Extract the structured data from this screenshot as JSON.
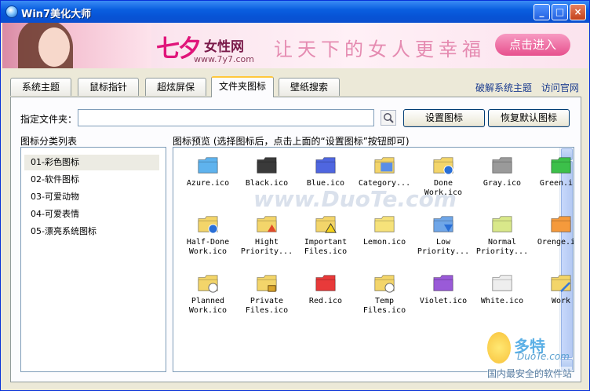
{
  "window": {
    "title": "Win7美化大师"
  },
  "banner": {
    "logo_main": "七夕",
    "logo_sub": "女性网",
    "logo_url": "www.7y7.com",
    "slogan": "让天下的女人更幸福",
    "enter_label": "点击进入"
  },
  "tabs": [
    {
      "label": "系统主题"
    },
    {
      "label": "鼠标指针"
    },
    {
      "label": "超炫屏保"
    },
    {
      "label": "文件夹图标"
    },
    {
      "label": "壁纸搜索"
    }
  ],
  "links": {
    "crack": "破解系统主题",
    "official": "访问官网"
  },
  "folder_row": {
    "label": "指定文件夹：",
    "value": "",
    "set_button": "设置图标",
    "restore_button": "恢复默认图标"
  },
  "category": {
    "title": "图标分类列表",
    "items": [
      {
        "label": "01-彩色图标"
      },
      {
        "label": "02-软件图标"
      },
      {
        "label": "03-可爱动物"
      },
      {
        "label": "04-可爱表情"
      },
      {
        "label": "05-漂亮系统图标"
      }
    ]
  },
  "preview": {
    "title": "图标预览 (选择图标后，点击上面的“设置图标”按钮即可)",
    "icons": [
      {
        "name": "Azure.ico",
        "color": "#5fb3ee",
        "badge": ""
      },
      {
        "name": "Black.ico",
        "color": "#3a3a3a",
        "badge": ""
      },
      {
        "name": "Blue.ico",
        "color": "#4f66e0",
        "badge": ""
      },
      {
        "name": "Category...",
        "color": "#f3d56a",
        "badge": "grid"
      },
      {
        "name": "Done Work.ico",
        "color": "#f3d56a",
        "badge": "globe"
      },
      {
        "name": "Gray.ico",
        "color": "#9a9a9a",
        "badge": ""
      },
      {
        "name": "Green.ico",
        "color": "#3cc04a",
        "badge": ""
      },
      {
        "name": "Half-Done Work.ico",
        "color": "#f3d56a",
        "badge": "globe"
      },
      {
        "name": "Hight Priority...",
        "color": "#f3d56a",
        "badge": "up"
      },
      {
        "name": "Important Files.ico",
        "color": "#f3d56a",
        "badge": "warn"
      },
      {
        "name": "Lemon.ico",
        "color": "#f6e27a",
        "badge": ""
      },
      {
        "name": "Low Priority...",
        "color": "#6fa6e8",
        "badge": "down"
      },
      {
        "name": "Normal Priority...",
        "color": "#d9e88a",
        "badge": ""
      },
      {
        "name": "Orenge.ico",
        "color": "#f59a3c",
        "badge": ""
      },
      {
        "name": "Planned Work.ico",
        "color": "#f3d56a",
        "badge": "clock"
      },
      {
        "name": "Private Files.ico",
        "color": "#f3d56a",
        "badge": "lock"
      },
      {
        "name": "Red.ico",
        "color": "#e83a3a",
        "badge": ""
      },
      {
        "name": "Temp Files.ico",
        "color": "#f3d56a",
        "badge": "clock"
      },
      {
        "name": "Violet.ico",
        "color": "#9a5ad8",
        "badge": ""
      },
      {
        "name": "White.ico",
        "color": "#eeeeee",
        "badge": ""
      },
      {
        "name": "Work",
        "color": "#f3d56a",
        "badge": "pen"
      }
    ]
  },
  "watermark": {
    "site": "www.DuoTe.com",
    "brand": "多特",
    "brand_en": "DuoTe.com",
    "line": "国内最安全的软件站"
  }
}
